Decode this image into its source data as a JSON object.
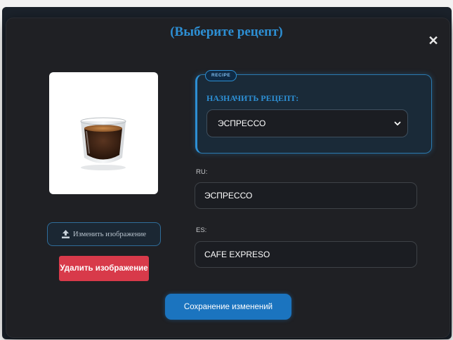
{
  "modal": {
    "title": "(Выберите рецепт)",
    "close_symbol": "✕"
  },
  "image": {
    "icon": "espresso-cup-image",
    "change_label": "Изменить изображение",
    "change_icon": "upload-icon",
    "delete_label": "Удалить изображение"
  },
  "recipe": {
    "badge": "RECIPE",
    "label": "НАЗНАЧИТЬ РЕЦЕПТ:",
    "selected": "ЭСПРЕССО",
    "dropdown_icon": "chevron-down-icon"
  },
  "translations": {
    "ru_label": "RU:",
    "ru_value": "ЭСПРЕССО",
    "es_label": "ES:",
    "es_value": "CAFE EXPRESO"
  },
  "actions": {
    "save_label": "Сохранение изменений"
  },
  "colors": {
    "accent": "#2d8fd4",
    "danger": "#d83a4a",
    "primary_button": "#1b74bf",
    "modal_bg": "#1f2024"
  }
}
